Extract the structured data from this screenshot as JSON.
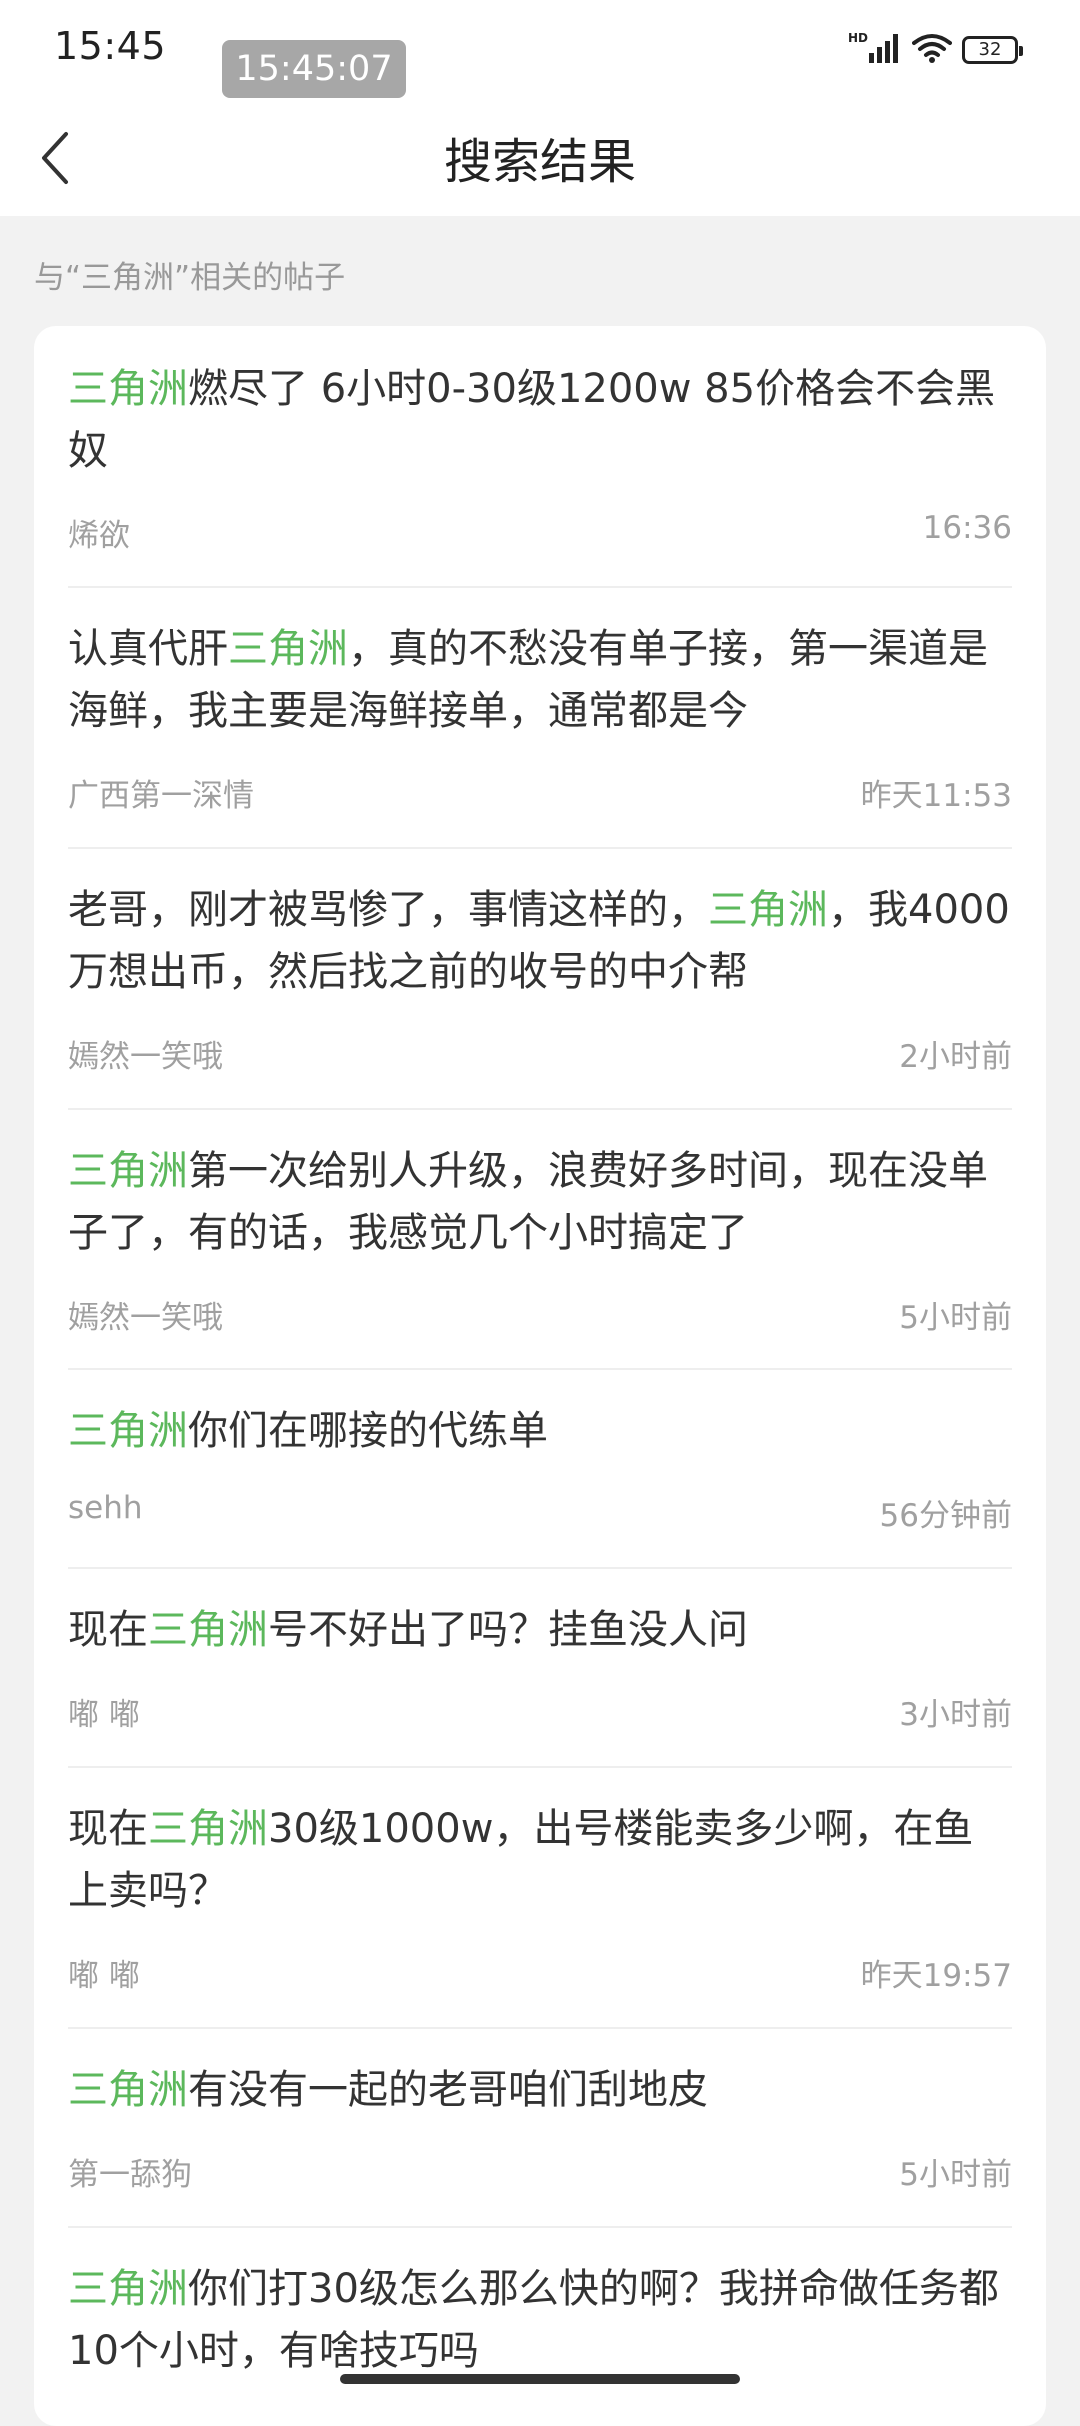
{
  "status_bar": {
    "time": "15:45",
    "badge_time": "15:45:07",
    "network": "HD",
    "battery": "32"
  },
  "nav": {
    "title": "搜索结果"
  },
  "section_label": "与“三角洲”相关的帖子",
  "colors": {
    "highlight": "#5cb85c",
    "meta_text": "#a0a0a0",
    "background": "#f2f2f2"
  },
  "posts": [
    {
      "highlight": "三角洲",
      "before": "",
      "after": "燃尽了 6小时0-30级1200w 85价格会不会黑奴",
      "author": "烯欲",
      "time": "16:36"
    },
    {
      "highlight": "三角洲",
      "before": "认真代肝",
      "after": "，真的不愁没有单子接，第一渠道是海鲜，我主要是海鲜接单，通常都是今",
      "author": "广西第一深情",
      "time": "昨天11:53"
    },
    {
      "highlight": "三角洲",
      "before": "老哥，刚才被骂惨了，事情这样的，",
      "after": "，我4000万想出币，然后找之前的收号的中介帮",
      "author": "嫣然一笑哦",
      "time": "2小时前"
    },
    {
      "highlight": "三角洲",
      "before": "",
      "after": "第一次给别人升级，浪费好多时间，现在没单子了，有的话，我感觉几个小时搞定了",
      "author": "嫣然一笑哦",
      "time": "5小时前"
    },
    {
      "highlight": "三角洲",
      "before": "",
      "after": "你们在哪接的代练单",
      "author": "sehh",
      "time": "56分钟前"
    },
    {
      "highlight": "三角洲",
      "before": "现在",
      "after": "号不好出了吗？挂鱼没人问",
      "author": "嘟 嘟",
      "time": "3小时前"
    },
    {
      "highlight": "三角洲",
      "before": "现在",
      "after": "30级1000w，出号楼能卖多少啊，在鱼上卖吗？",
      "author": "嘟 嘟",
      "time": "昨天19:57"
    },
    {
      "highlight": "三角洲",
      "before": "",
      "after": "有没有一起的老哥咱们刮地皮",
      "author": "第一舔狗",
      "time": "5小时前"
    },
    {
      "highlight": "三角洲",
      "before": "",
      "after": "你们打30级怎么那么快的啊？我拼命做任务都10个小时，有啥技巧吗",
      "author": "",
      "time": ""
    }
  ]
}
